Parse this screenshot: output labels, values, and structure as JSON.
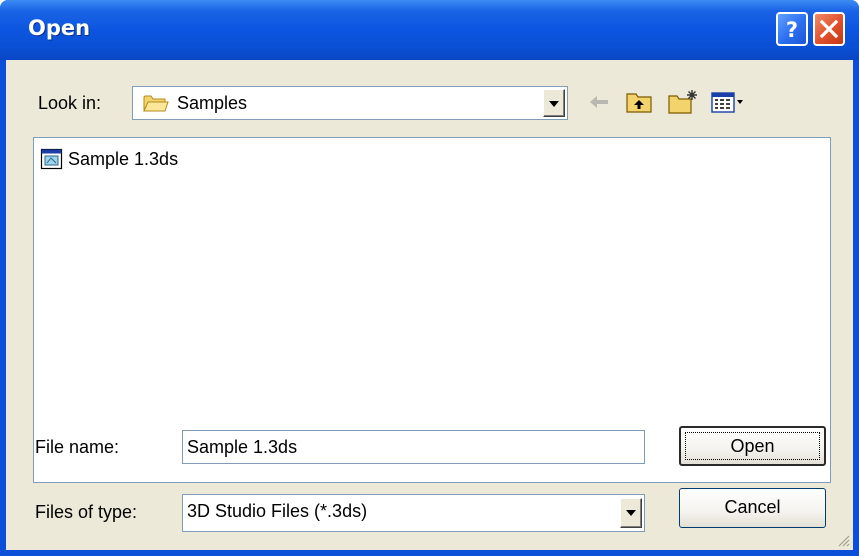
{
  "window": {
    "title": "Open"
  },
  "toolbar": {
    "look_in_label": "Look in:",
    "look_in_value": "Samples"
  },
  "files": [
    {
      "name": "Sample 1.3ds"
    }
  ],
  "form": {
    "file_name_label": "File name:",
    "file_name_value": "Sample 1.3ds",
    "file_type_label": "Files of type:",
    "file_type_value": "3D Studio Files (*.3ds)"
  },
  "buttons": {
    "open": "Open",
    "cancel": "Cancel"
  },
  "colors": {
    "title_bar": "#0c55e0",
    "dialog_face": "#ece9d8",
    "close_button": "#e0502a",
    "help_button": "#2c6ef0"
  }
}
